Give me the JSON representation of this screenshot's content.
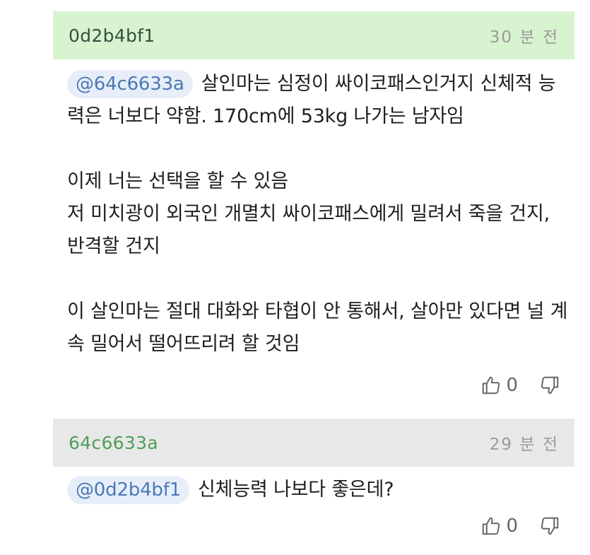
{
  "comments": [
    {
      "author": "0d2b4bf1",
      "time": "30 분 전",
      "mention": "@64c6633a",
      "paragraphs": [
        "살인마는 심정이 싸이코패스인거지 신체적 능력은 너보다 약함. 170cm에 53kg 나가는 남자임",
        "이제 너는 선택을 할 수 있음",
        "저 미치광이 외국인 개멸치 싸이코패스에게 밀려서 죽을 건지, 반격할 건지",
        "이 살인마는 절대 대화와 타협이 안 통해서, 살아만 있다면 널 계속 밀어서 떨어뜨리려 할 것임"
      ],
      "likes": "0"
    },
    {
      "author": "64c6633a",
      "time": "29 분 전",
      "mention": "@0d2b4bf1",
      "paragraphs": [
        "신체능력 나보다 좋은데?"
      ],
      "likes": "0"
    }
  ],
  "icons": {
    "like": "thumbs-up-icon",
    "dislike": "thumbs-down-icon"
  },
  "colors": {
    "header_mine": "#d8f3cf",
    "header_other": "#e8e8e8",
    "mention_bg": "#e7eef9",
    "mention_text": "#4b79b5"
  }
}
